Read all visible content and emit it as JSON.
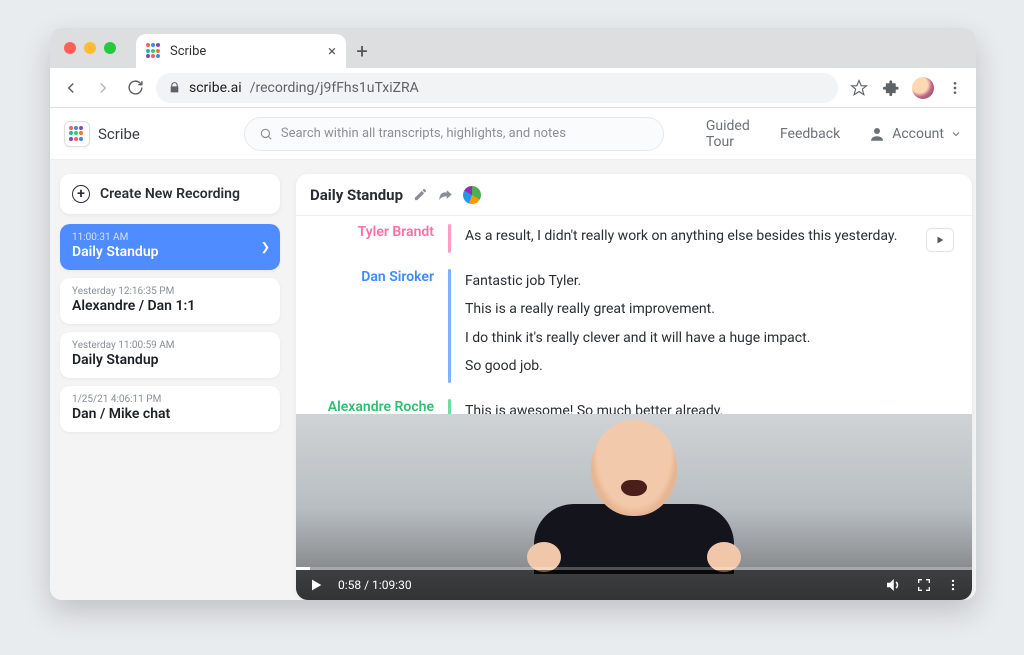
{
  "browser": {
    "tab_title": "Scribe",
    "url_host": "scribe.ai",
    "url_path": "/recording/j9fFhs1uTxiZRA"
  },
  "header": {
    "brand": "Scribe",
    "search_placeholder": "Search within all transcripts, highlights, and notes",
    "guided_tour": "Guided Tour",
    "feedback": "Feedback",
    "account": "Account"
  },
  "sidebar": {
    "new_recording_label": "Create New Recording",
    "recordings": [
      {
        "timestamp": "11:00:31 AM",
        "title": "Daily Standup",
        "active": true
      },
      {
        "timestamp": "Yesterday 12:16:35 PM",
        "title": "Alexandre / Dan 1:1",
        "active": false
      },
      {
        "timestamp": "Yesterday 11:00:59 AM",
        "title": "Daily Standup",
        "active": false
      },
      {
        "timestamp": "1/25/21 4:06:11 PM",
        "title": "Dan / Mike chat",
        "active": false
      }
    ]
  },
  "panel": {
    "title": "Daily Standup",
    "transcript": [
      {
        "speaker": "Tyler Brandt",
        "color": "pink",
        "lines": [
          "As a result, I didn't really work on anything else besides this yesterday."
        ]
      },
      {
        "speaker": "Dan Siroker",
        "color": "blue",
        "lines": [
          "Fantastic job Tyler.",
          "This is a really really great improvement.",
          "I do think it's really clever and it will have a huge impact.",
          "So good job."
        ]
      },
      {
        "speaker": "Alexandre Roche",
        "color": "green",
        "lines": [
          "This is awesome! So much better already."
        ]
      }
    ]
  },
  "video": {
    "current_time": "0:58",
    "duration": "1:09:30"
  }
}
